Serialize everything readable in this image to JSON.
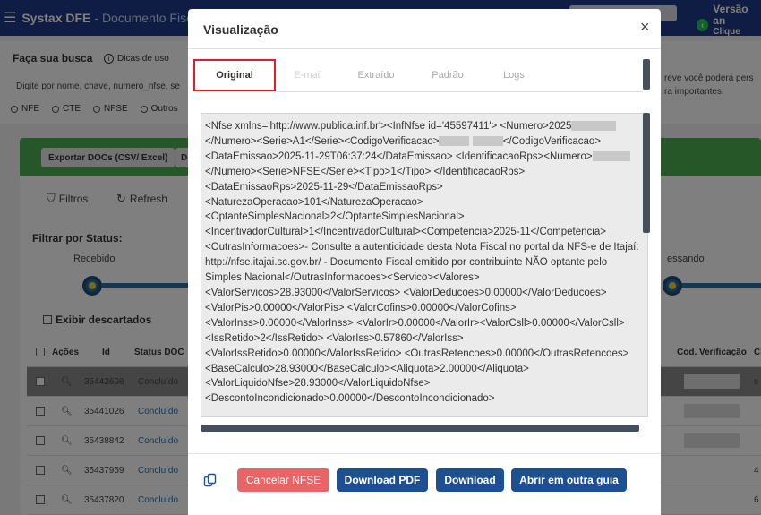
{
  "app": {
    "brand_name": "Systax DFE",
    "brand_sub": "- Documento Fiscal",
    "version_title": "Versão an",
    "version_sub": "Clique aqui",
    "version_icon": "chevron-left-icon"
  },
  "search": {
    "title": "Faça sua busca",
    "tips": "Dicas de uso",
    "hint": "Digite por nome, chave, numero_nfse, se",
    "right_text_1": "reve você poderá pers",
    "right_text_2": "ra importantes.",
    "radios": [
      "NFE",
      "CTE",
      "NFSE",
      "Outros"
    ]
  },
  "toolbar": {
    "export_label": "Exportar DOCs (CSV/ Excel)",
    "export2_label": "D",
    "filters_label": "Filtros",
    "refresh_label": "Refresh"
  },
  "status": {
    "title": "Filtrar por Status:",
    "received": "Recebido",
    "processed": "essando",
    "discard_label": "Exibir descartados"
  },
  "table": {
    "headers": {
      "actions": "Ações",
      "id": "Id",
      "status": "Status DOC",
      "cod": "Cod. Verificação",
      "last": "C"
    },
    "rows": [
      {
        "id": "35442608",
        "status": "Concluído",
        "last": "c"
      },
      {
        "id": "35441026",
        "status": "Concluído",
        "last": ""
      },
      {
        "id": "35438842",
        "status": "Concluído",
        "last": ""
      },
      {
        "id": "35437959",
        "status": "Concluído",
        "last": "4"
      },
      {
        "id": "35437820",
        "status": "Concluído",
        "last": "6"
      }
    ]
  },
  "modal": {
    "title": "Visualização",
    "close": "×",
    "tabs": [
      "Original",
      "E-mail",
      "Extraído",
      "Padrão",
      "Logs"
    ],
    "active_tab": "Original",
    "xml_lines": {
      "l1": "<Nfse xmlns='http://www.publica.inf.br'><InfNfse id='45597411'>",
      "l2a": "<Numero>2025",
      "l2b": "</Numero><Serie>A1</Serie><CodigoVerificacao>",
      "l3": "</CodigoVerificacao><DataEmissao>2025-11-29T06:37:24</DataEmissao>",
      "l4a": "<IdentificacaoRps><Numero>",
      "l4b": "</Numero><Serie>NFSE</Serie><Tipo>1</Tipo>",
      "l5": "</IdentificacaoRps><DataEmissaoRps>2025-11-29</DataEmissaoRps>",
      "l6": "<NaturezaOperacao>101</NaturezaOperacao>",
      "l7": "<OptanteSimplesNacional>2</OptanteSimplesNacional>",
      "l8": "<IncentivadorCultural>1</IncentivadorCultural><Competencia>2025-11</Competencia>",
      "l9": "<OutrasInformacoes>- Consulte a autenticidade desta Nota Fiscal no portal da NFS-e de Itajaí: http://nfse.itajai.sc.gov.br/ - Documento Fiscal emitido por contribuinte NÃO optante pelo Simples Nacional</OutrasInformacoes><Servico><Valores>",
      "l10": "<ValorServicos>28.93000</ValorServicos>",
      "l11": "<ValorDeducoes>0.00000</ValorDeducoes><ValorPis>0.00000</ValorPis>",
      "l12": "<ValorCofins>0.00000</ValorCofins><ValorInss>0.00000</ValorInss>",
      "l13": "<ValorIr>0.00000</ValorIr><ValorCsll>0.00000</ValorCsll><IssRetido>2</IssRetido>",
      "l14": "<ValorIss>0.57860</ValorIss><ValorIssRetido>0.00000</ValorIssRetido>",
      "l15": "<OutrasRetencoes>0.00000</OutrasRetencoes>",
      "l16": "<BaseCalculo>28.93000</BaseCalculo><Aliquota>2.00000</Aliquota>",
      "l17": "<ValorLiquidoNfse>28.93000</ValorLiquidoNfse>",
      "l18": "<DescontoIncondicionado>0.00000</DescontoIncondicionado>"
    },
    "buttons": {
      "cancel": "Cancelar NFSE",
      "pdf": "Download PDF",
      "download": "Download",
      "open_tab": "Abrir em outra guia"
    },
    "colors": {
      "active_tab_border": "#e11d2a",
      "primary": "#1d4f91",
      "danger": "#e96466"
    }
  }
}
